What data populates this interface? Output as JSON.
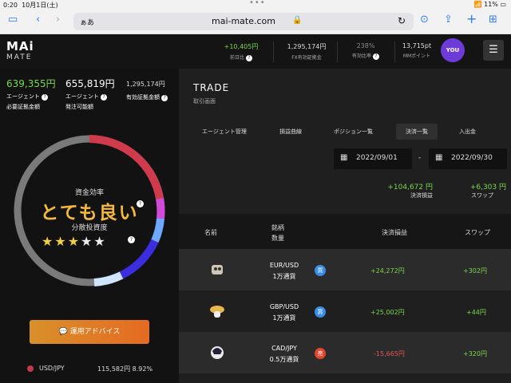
{
  "status": {
    "time": "0:20",
    "date": "10月1日(土)",
    "battery": "11%"
  },
  "browser": {
    "aa": "ぁあ",
    "url": "mai-mate.com"
  },
  "header": {
    "logo_main": "MAi",
    "logo_sub": "MATE",
    "stats": [
      {
        "value": "+10,405円",
        "label": "前日比",
        "green": true
      },
      {
        "value": "1,295,174円",
        "label": "FX有効証拠金"
      },
      {
        "value": "238%",
        "label": "有効比率"
      },
      {
        "value": "13,715pt",
        "label": "MMポイント"
      }
    ],
    "you": "YOU"
  },
  "left": {
    "stats": [
      {
        "value": "639,355円",
        "label": "エージェント",
        "label2": "必要証拠金額"
      },
      {
        "value": "655,819円",
        "label": "エージェント",
        "label2": "発注可能額"
      },
      {
        "value": "1,295,174円",
        "label": "有効証拠金額"
      }
    ],
    "eff_label": "資金効率",
    "eff_value": "とても良い",
    "div_label": "分散投資度",
    "stars_filled": 3,
    "stars_total": 5,
    "advice": "運用アドバイス",
    "pair": {
      "name": "USD/JPY",
      "amount": "115,582円",
      "pct": "8.92%"
    }
  },
  "main": {
    "title": "TRADE",
    "subtitle": "取引画面",
    "tabs": [
      "エージェント管理",
      "損益曲線",
      "ポジション一覧",
      "決済一覧",
      "入出金"
    ],
    "active_tab": 3,
    "date_from": "2022/09/01",
    "date_to": "2022/09/30",
    "date_sep": "-",
    "sum_profit": "+104,672 円",
    "sum_profit_label": "決済損益",
    "sum_swap": "+6,303 円",
    "sum_swap_label": "スワップ",
    "headers": {
      "name": "名前",
      "pair": "銘柄",
      "qty": "数量",
      "profit": "決済損益",
      "swap": "スワップ"
    },
    "rows": [
      {
        "pair": "EUR/USD",
        "qty": "1万通貨",
        "side": "買",
        "profit": "+24,272円",
        "swap": "+302円",
        "profit_pos": true
      },
      {
        "pair": "GBP/USD",
        "qty": "1万通貨",
        "side": "買",
        "profit": "+25,002円",
        "swap": "+44円",
        "profit_pos": true
      },
      {
        "pair": "CAD/JPY",
        "qty": "0.5万通貨",
        "side": "売",
        "profit": "-15,665円",
        "swap": "+320円",
        "profit_pos": false
      }
    ]
  },
  "colors": {
    "green": "#7bd84b",
    "red": "#e45858",
    "gold": "#f4b93c",
    "buy": "#3a8ee6",
    "sell": "#e0472e"
  }
}
